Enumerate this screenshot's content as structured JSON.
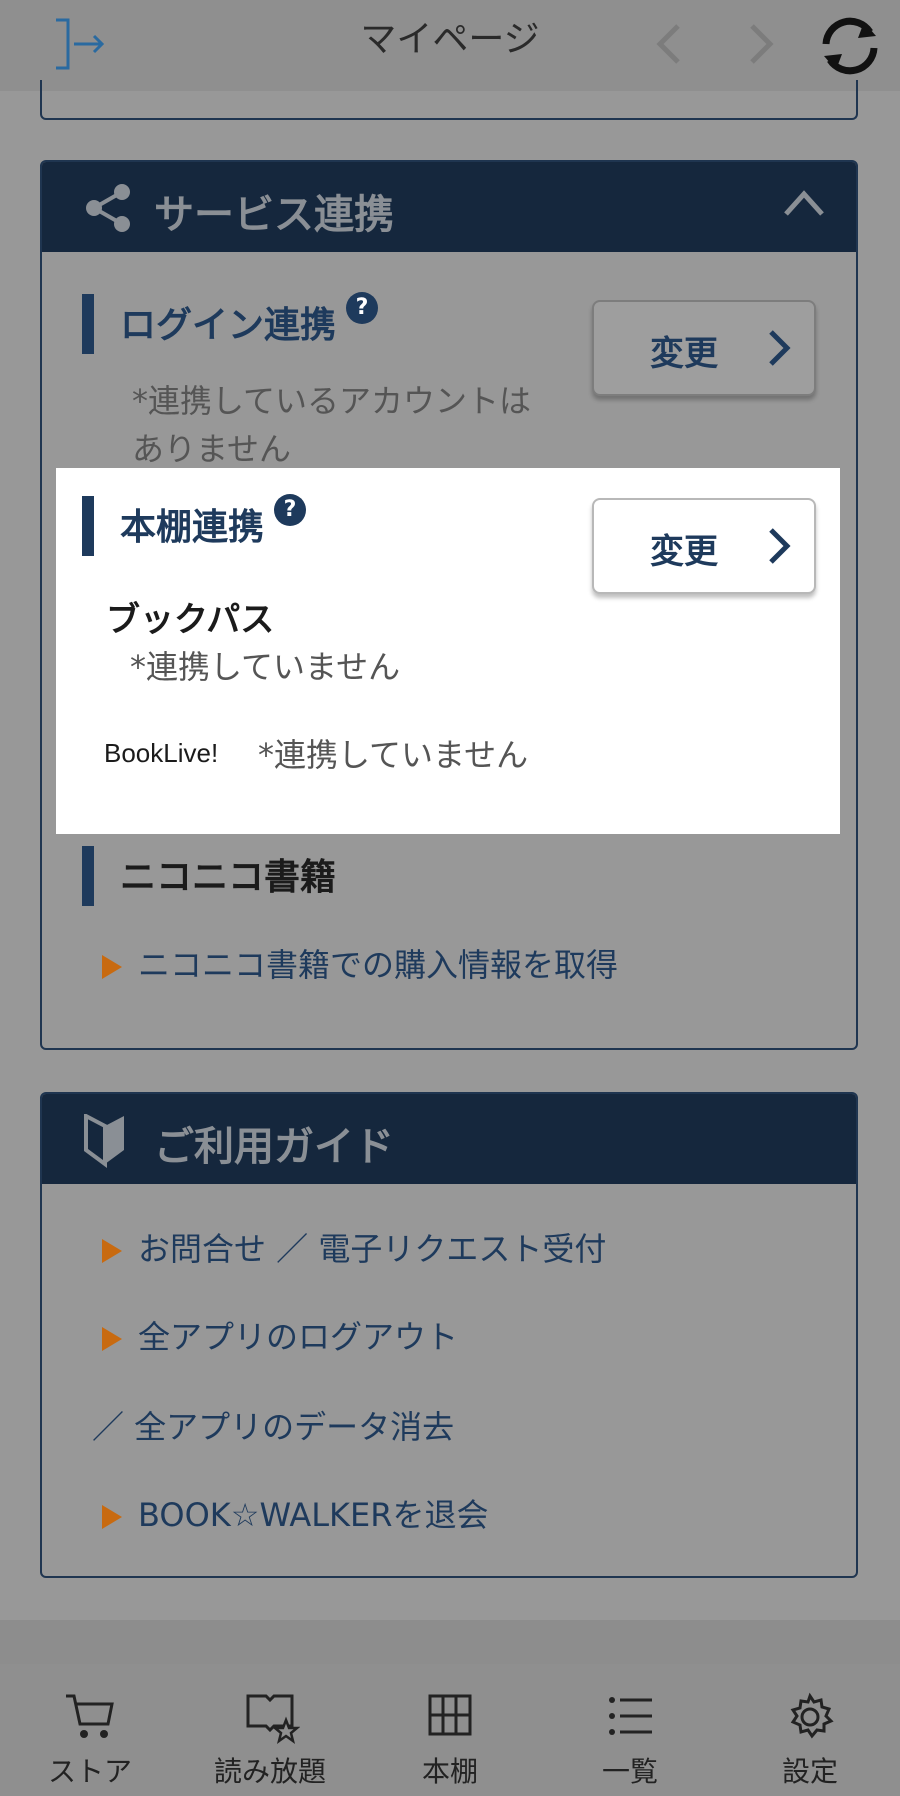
{
  "header": {
    "title": "マイページ"
  },
  "service": {
    "title": "サービス連携",
    "login": {
      "title": "ログイン連携",
      "help": "?",
      "note_line1": "*連携しているアカウントは",
      "note_line2": "ありません",
      "button": "変更"
    },
    "shelf": {
      "title": "本棚連携",
      "help": "?",
      "button": "変更",
      "bookpass_title": "ブックパス",
      "bookpass_status": "*連携していません",
      "booklive_label": "BookLive!",
      "booklive_status": "*連携していません"
    },
    "niconico": {
      "title": "ニコニコ書籍",
      "link": "ニコニコ書籍での購入情報を取得"
    }
  },
  "guide": {
    "title": "ご利用ガイド",
    "links": [
      "お問合せ ／ 電子リクエスト受付",
      "全アプリのログアウト",
      "／ 全アプリのデータ消去",
      "BOOK☆WALKERを退会"
    ]
  },
  "bottom_nav": [
    {
      "label": "ストア",
      "icon": "cart-icon"
    },
    {
      "label": "読み放題",
      "icon": "book-star-icon"
    },
    {
      "label": "本棚",
      "icon": "grid-icon"
    },
    {
      "label": "一覧",
      "icon": "list-icon"
    },
    {
      "label": "設定",
      "icon": "gear-icon"
    }
  ],
  "colors": {
    "accent": "#1e3a5c",
    "header_bg": "#15273d",
    "arrow": "#c86a10"
  }
}
